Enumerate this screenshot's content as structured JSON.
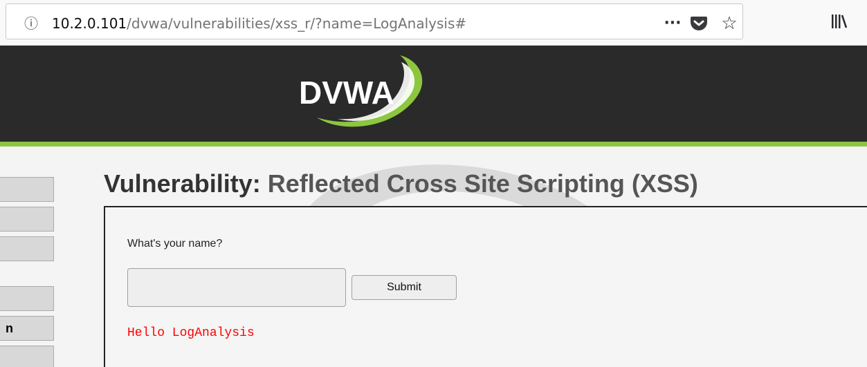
{
  "browser": {
    "url_host": "10.2.0.101",
    "url_path": "/dvwa/vulnerabilities/xss_r/?name=LogAnalysis#",
    "icons": [
      "info-icon",
      "more-icon",
      "pocket-icon",
      "star-icon",
      "library-icon"
    ]
  },
  "header": {
    "logo_text": "DVWA",
    "colors": {
      "background": "#2a2a2a",
      "accent": "#8dc63f"
    }
  },
  "sidebar": {
    "items": [
      {
        "label": ""
      },
      {
        "label": ""
      },
      {
        "label": ""
      },
      {
        "label": ""
      },
      {
        "label": "n"
      },
      {
        "label": ""
      }
    ]
  },
  "main": {
    "title_prefix": "Vulnerability: ",
    "title_rest": "Reflected Cross Site Scripting (XSS)",
    "form": {
      "label": "What's your name?",
      "input_value": "",
      "submit_label": "Submit"
    },
    "output": "Hello LogAnalysis",
    "output_color": "#ff0000"
  }
}
